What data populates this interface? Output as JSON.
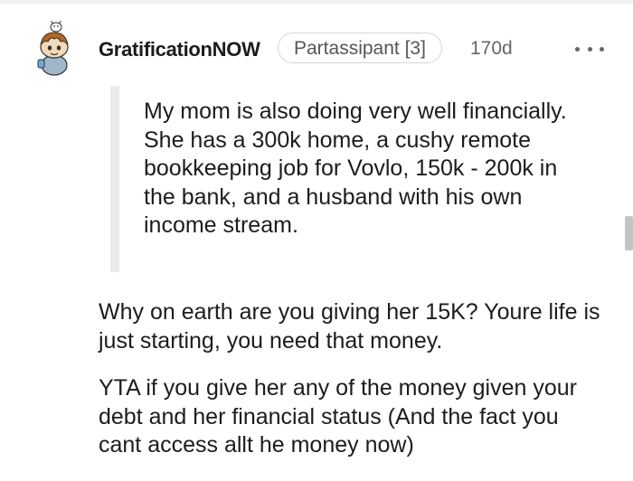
{
  "comment": {
    "author": "GratificationNOW",
    "flair": "Partassipant [3]",
    "age": "170d",
    "quote": "My mom is also doing very well financially. She has a 300k home, a cushy remote bookkeeping job for Vovlo, 150k - 200k in the bank, and a husband with his own income stream.",
    "paragraphs": [
      "Why on earth are you giving her 15K? Youre life is just starting, you need that money.",
      "YTA if you give her any of the money given your debt and her financial status (And the fact you cant access allt he money now)"
    ]
  },
  "icons": {
    "avatar": "snoo-avatar-icon",
    "more": "more-options-icon"
  },
  "colors": {
    "text": "#1c1c1c",
    "meta": "#666666",
    "quote_bar": "#ebebeb",
    "flair_border": "#d6d6d6"
  }
}
